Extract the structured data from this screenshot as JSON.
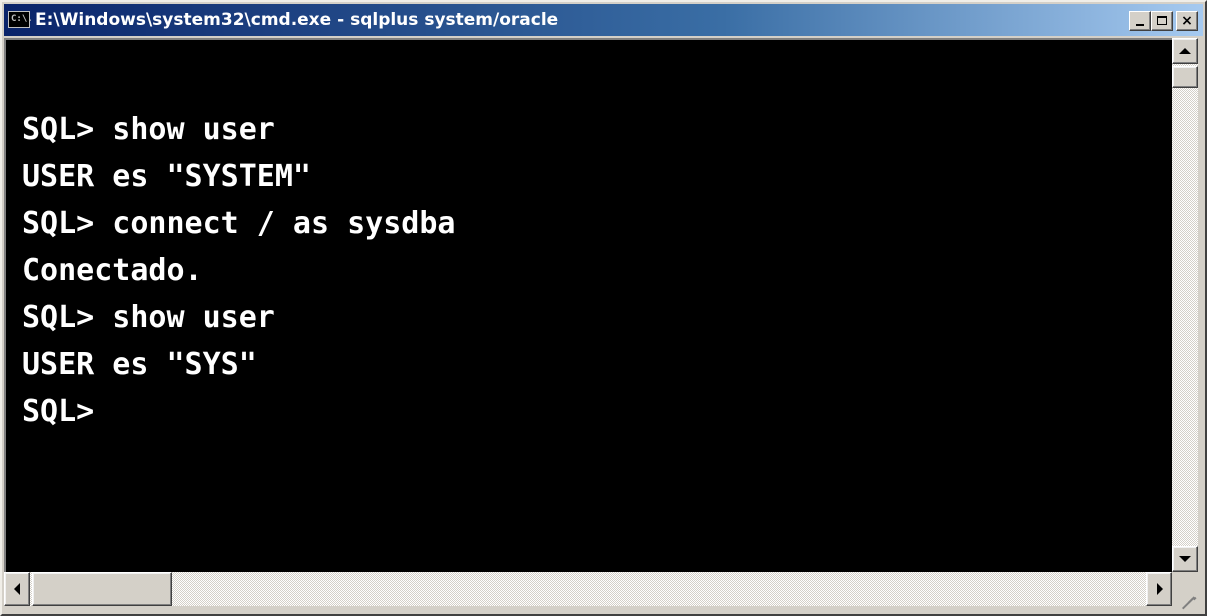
{
  "window": {
    "title": "E:\\Windows\\system32\\cmd.exe - sqlplus  system/oracle",
    "icon_label": "C:\\.",
    "controls": {
      "minimize": "minimize-icon",
      "maximize": "maximize-icon",
      "close": "×"
    }
  },
  "console": {
    "lines": [
      "SQL> show user",
      "USER es \"SYSTEM\"",
      "SQL> connect / as sysdba",
      "Conectado.",
      "SQL> show user",
      "USER es \"SYS\"",
      "SQL>"
    ],
    "background": "#000000",
    "foreground": "#ffffff"
  },
  "colors": {
    "title_start": "#0a246a",
    "title_end": "#a6caf0",
    "chrome": "#d4d0c8"
  }
}
